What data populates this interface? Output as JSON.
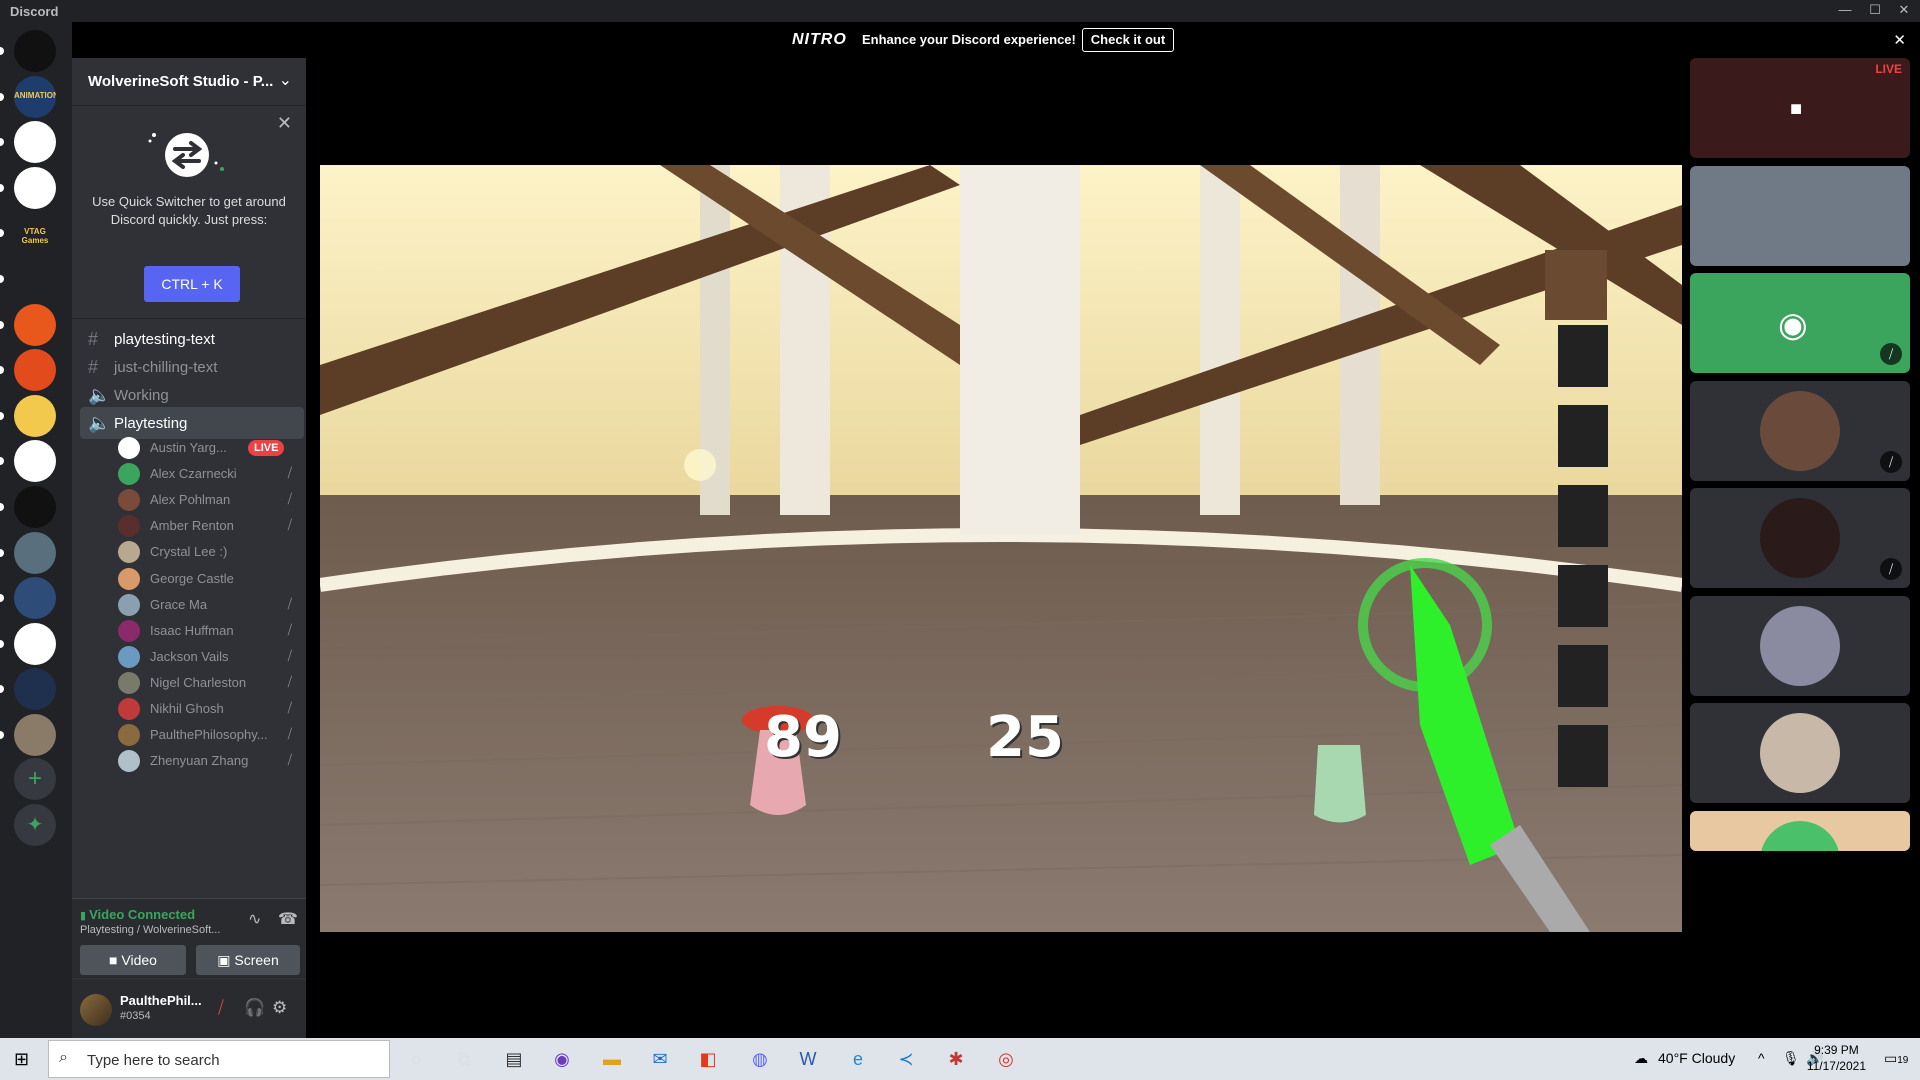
{
  "window": {
    "app_title": "Discord",
    "minimize": "—",
    "maximize": "☐",
    "close": "✕"
  },
  "nitro_banner": {
    "logo": "NITRO",
    "message": "Enhance your Discord experience!",
    "cta": "Check it out",
    "close": "✕"
  },
  "guilds": [
    {
      "name": "server-1",
      "color": "#111111"
    },
    {
      "name": "server-2",
      "color": "#1e3d6d",
      "label": "ANIMATION"
    },
    {
      "name": "server-3",
      "color": "#ffffff"
    },
    {
      "name": "server-4",
      "color": "#ffffff"
    },
    {
      "name": "server-5",
      "color": "#202225",
      "label": "VTAG Games"
    },
    {
      "name": "server-6",
      "color": "#202225"
    },
    {
      "name": "server-7",
      "color": "#e8571c"
    },
    {
      "name": "server-8",
      "color": "#e24b1b"
    },
    {
      "name": "server-9",
      "color": "#f2c94c"
    },
    {
      "name": "server-10",
      "color": "#ffffff"
    },
    {
      "name": "server-11",
      "color": "#111111"
    },
    {
      "name": "server-12",
      "color": "#596f7e"
    },
    {
      "name": "server-13",
      "color": "#2d4c78"
    },
    {
      "name": "server-14",
      "color": "#ffffff"
    },
    {
      "name": "server-15",
      "color": "#1f2f4e"
    },
    {
      "name": "server-16",
      "color": "#8a7a68"
    }
  ],
  "server": {
    "name": "WolverineSoft Studio - P...",
    "chevron": "⌄"
  },
  "quick_switcher": {
    "close": "✕",
    "text": "Use Quick Switcher to get around Discord quickly. Just press:",
    "shortcut": "CTRL + K"
  },
  "channels": [
    {
      "type": "text",
      "icon": "#",
      "label": "playtesting-text",
      "state": "unread"
    },
    {
      "type": "text",
      "icon": "#",
      "label": "just-chilling-text",
      "state": "normal"
    },
    {
      "type": "voice",
      "icon": "🔈",
      "label": "Working",
      "state": "normal"
    },
    {
      "type": "voice",
      "icon": "🔈",
      "label": "Playtesting",
      "state": "selected"
    }
  ],
  "voice_members": [
    {
      "name": "Austin Yarg...",
      "color": "#ffffff",
      "live": "LIVE",
      "camera": "▶"
    },
    {
      "name": "Alex Czarnecki",
      "color": "#3ba55d",
      "mic": "⧸"
    },
    {
      "name": "Alex Pohlman",
      "color": "#7a4a3a",
      "mic": "⧸"
    },
    {
      "name": "Amber Renton",
      "color": "#5a2e2e",
      "mic": "⧸"
    },
    {
      "name": "Crystal Lee :)",
      "color": "#b8a890"
    },
    {
      "name": "George Castle",
      "color": "#d89a6a"
    },
    {
      "name": "Grace Ma",
      "color": "#8aa0b0",
      "mic": "⧸"
    },
    {
      "name": "Isaac Huffman",
      "color": "#8a2a6a",
      "mic": "⧸"
    },
    {
      "name": "Jackson Vails",
      "color": "#6a9ac0",
      "mic": "⧸"
    },
    {
      "name": "Nigel Charleston",
      "color": "#7a7a6a",
      "mic": "⧸"
    },
    {
      "name": "Nikhil Ghosh",
      "color": "#c03a3a",
      "mic": "⧸"
    },
    {
      "name": "PaulthePhilosophy...",
      "color": "#8a6a3e",
      "mic": "⧸"
    },
    {
      "name": "Zhenyuan Zhang",
      "color": "#b0c0c8",
      "mic": "⧸"
    }
  ],
  "rtc": {
    "status": "Video Connected",
    "channel": "Playtesting / WolverineSoft...",
    "video_label": "Video",
    "screen_label": "Screen"
  },
  "user": {
    "name": "PaulthePhil...",
    "tag": "#0354"
  },
  "game_hud": {
    "health": "89",
    "mana": "25"
  },
  "tiles": [
    {
      "name": "stream-preview",
      "live": "LIVE",
      "color": "#3a1a1a"
    },
    {
      "name": "webcam",
      "color": "#6f7a86"
    },
    {
      "name": "discord-default",
      "color": "#3ba55d"
    },
    {
      "name": "avatar-1",
      "color": "#2f3136",
      "avatar_color": "#6a4a3a"
    },
    {
      "name": "avatar-2",
      "color": "#2f3136",
      "avatar_color": "#2a1a1a"
    },
    {
      "name": "avatar-3",
      "color": "#2f3136",
      "avatar_color": "#8a8aa0"
    },
    {
      "name": "avatar-4",
      "color": "#2f3136",
      "avatar_color": "#c8b8a8"
    },
    {
      "name": "avatar-5",
      "color": "#e8c8a0",
      "avatar_color": "#4ac06a"
    }
  ],
  "taskbar": {
    "search_placeholder": "Type here to search",
    "weather": "40°F  Cloudy",
    "time": "9:39 PM",
    "date": "11/17/2021",
    "notifications": "19"
  },
  "colors": {
    "blurple": "#5865f2",
    "green": "#3ba55d",
    "red": "#ed4245"
  }
}
